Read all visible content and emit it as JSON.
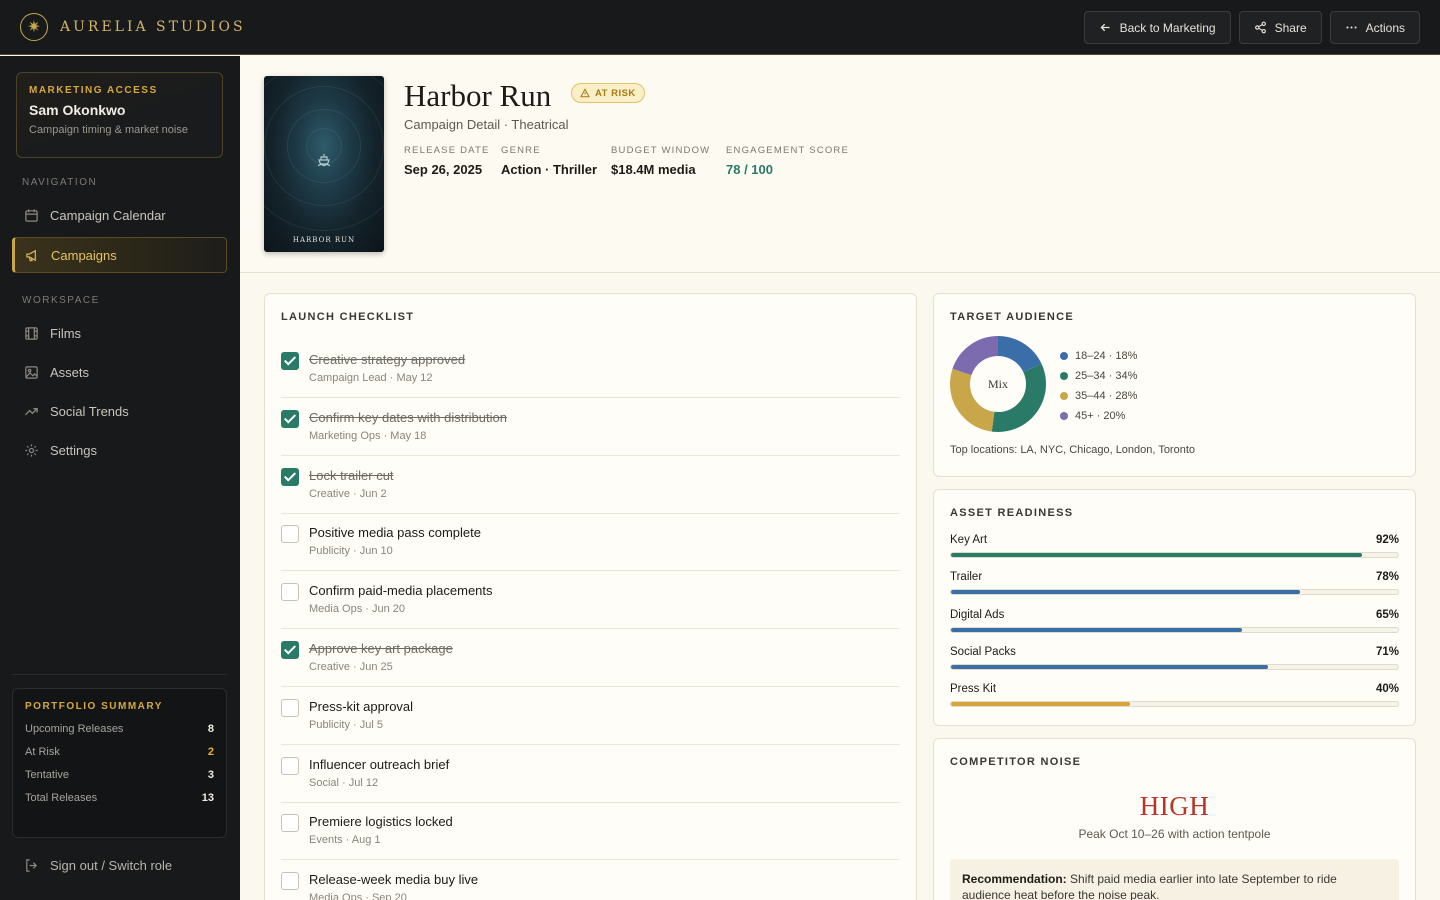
{
  "brand": {
    "name": "AURELIA STUDIOS"
  },
  "topbar": {
    "back_label": "Back to Marketing",
    "share_label": "Share",
    "actions_label": "Actions"
  },
  "sidebar": {
    "access": {
      "kicker": "MARKETING ACCESS",
      "name": "Sam Okonkwo",
      "sub": "Campaign timing & market noise"
    },
    "nav_heading": "NAVIGATION",
    "nav": [
      {
        "label": "Campaign Calendar",
        "icon": "calendar-icon"
      },
      {
        "label": "Campaigns",
        "icon": "megaphone-icon",
        "active": true
      }
    ],
    "workspace_heading": "WORKSPACE",
    "workspace": [
      {
        "label": "Films",
        "icon": "film-icon"
      },
      {
        "label": "Assets",
        "icon": "image-icon"
      },
      {
        "label": "Social Trends",
        "icon": "trend-icon"
      },
      {
        "label": "Settings",
        "icon": "gear-icon"
      }
    ],
    "summary": {
      "title": "PORTFOLIO SUMMARY",
      "rows": [
        {
          "label": "Upcoming Releases",
          "value": "8"
        },
        {
          "label": "At Risk",
          "value": "2"
        },
        {
          "label": "Tentative",
          "value": "3"
        },
        {
          "label": "Total Releases",
          "value": "13"
        }
      ]
    },
    "signout_label": "Sign out / Switch role"
  },
  "film": {
    "poster_title": "HARBOR RUN",
    "title": "Harbor Run",
    "badge": "AT RISK",
    "subtitle": "Campaign Detail · Theatrical",
    "meta": [
      {
        "label": "RELEASE DATE",
        "value": "Sep 26, 2025"
      },
      {
        "label": "GENRE",
        "value": "Action · Thriller"
      },
      {
        "label": "BUDGET WINDOW",
        "value": "$18.4M media"
      },
      {
        "label": "ENGAGEMENT SCORE",
        "value": "78 / 100"
      }
    ]
  },
  "checklist": {
    "title": "LAUNCH CHECKLIST",
    "items": [
      {
        "label": "Creative strategy approved",
        "meta": "Campaign Lead · May 12",
        "done": true
      },
      {
        "label": "Confirm key dates with distribution",
        "meta": "Marketing Ops · May 18",
        "done": true
      },
      {
        "label": "Lock trailer cut",
        "meta": "Creative · Jun 2",
        "done": true
      },
      {
        "label": "Positive media pass complete",
        "meta": "Publicity · Jun 10",
        "done": false
      },
      {
        "label": "Confirm paid-media placements",
        "meta": "Media Ops · Jun 20",
        "done": false
      },
      {
        "label": "Approve key art package",
        "meta": "Creative · Jun 25",
        "done": true
      },
      {
        "label": "Press-kit approval",
        "meta": "Publicity · Jul 5",
        "done": false
      },
      {
        "label": "Influencer outreach brief",
        "meta": "Social · Jul 12",
        "done": false
      },
      {
        "label": "Premiere logistics locked",
        "meta": "Events · Aug 1",
        "done": false
      },
      {
        "label": "Release-week media buy live",
        "meta": "Media Ops · Sep 20",
        "done": false
      }
    ]
  },
  "audience": {
    "title": "TARGET AUDIENCE",
    "center_label": "Mix",
    "segments": [
      {
        "label": "18–24 · 18%",
        "value": 18,
        "color": "#3a6ea8"
      },
      {
        "label": "25–34 · 34%",
        "value": 34,
        "color": "#2a7a68"
      },
      {
        "label": "35–44 · 28%",
        "value": 28,
        "color": "#c9a64a"
      },
      {
        "label": "45+ · 20%",
        "value": 20,
        "color": "#7d6bb0"
      }
    ],
    "locations": "Top locations: LA, NYC, Chicago, London, Toronto"
  },
  "readiness": {
    "title": "ASSET READINESS",
    "items": [
      {
        "label": "Key Art",
        "pct_label": "92%",
        "value": 92,
        "color": "#2a7a68"
      },
      {
        "label": "Trailer",
        "pct_label": "78%",
        "value": 78,
        "color": "#3a6ea8"
      },
      {
        "label": "Digital Ads",
        "pct_label": "65%",
        "value": 65,
        "color": "#3a6ea8"
      },
      {
        "label": "Social Packs",
        "pct_label": "71%",
        "value": 71,
        "color": "#3a6ea8"
      },
      {
        "label": "Press Kit",
        "pct_label": "40%",
        "value": 40,
        "color": "#d9a53a"
      }
    ]
  },
  "noise": {
    "title": "COMPETITOR NOISE",
    "level": "HIGH",
    "sub": "Peak Oct 10–26 with action tentpole",
    "reco_label": "Recommendation:",
    "reco_text": "Shift paid media earlier into late September to ride audience heat before the noise peak."
  }
}
